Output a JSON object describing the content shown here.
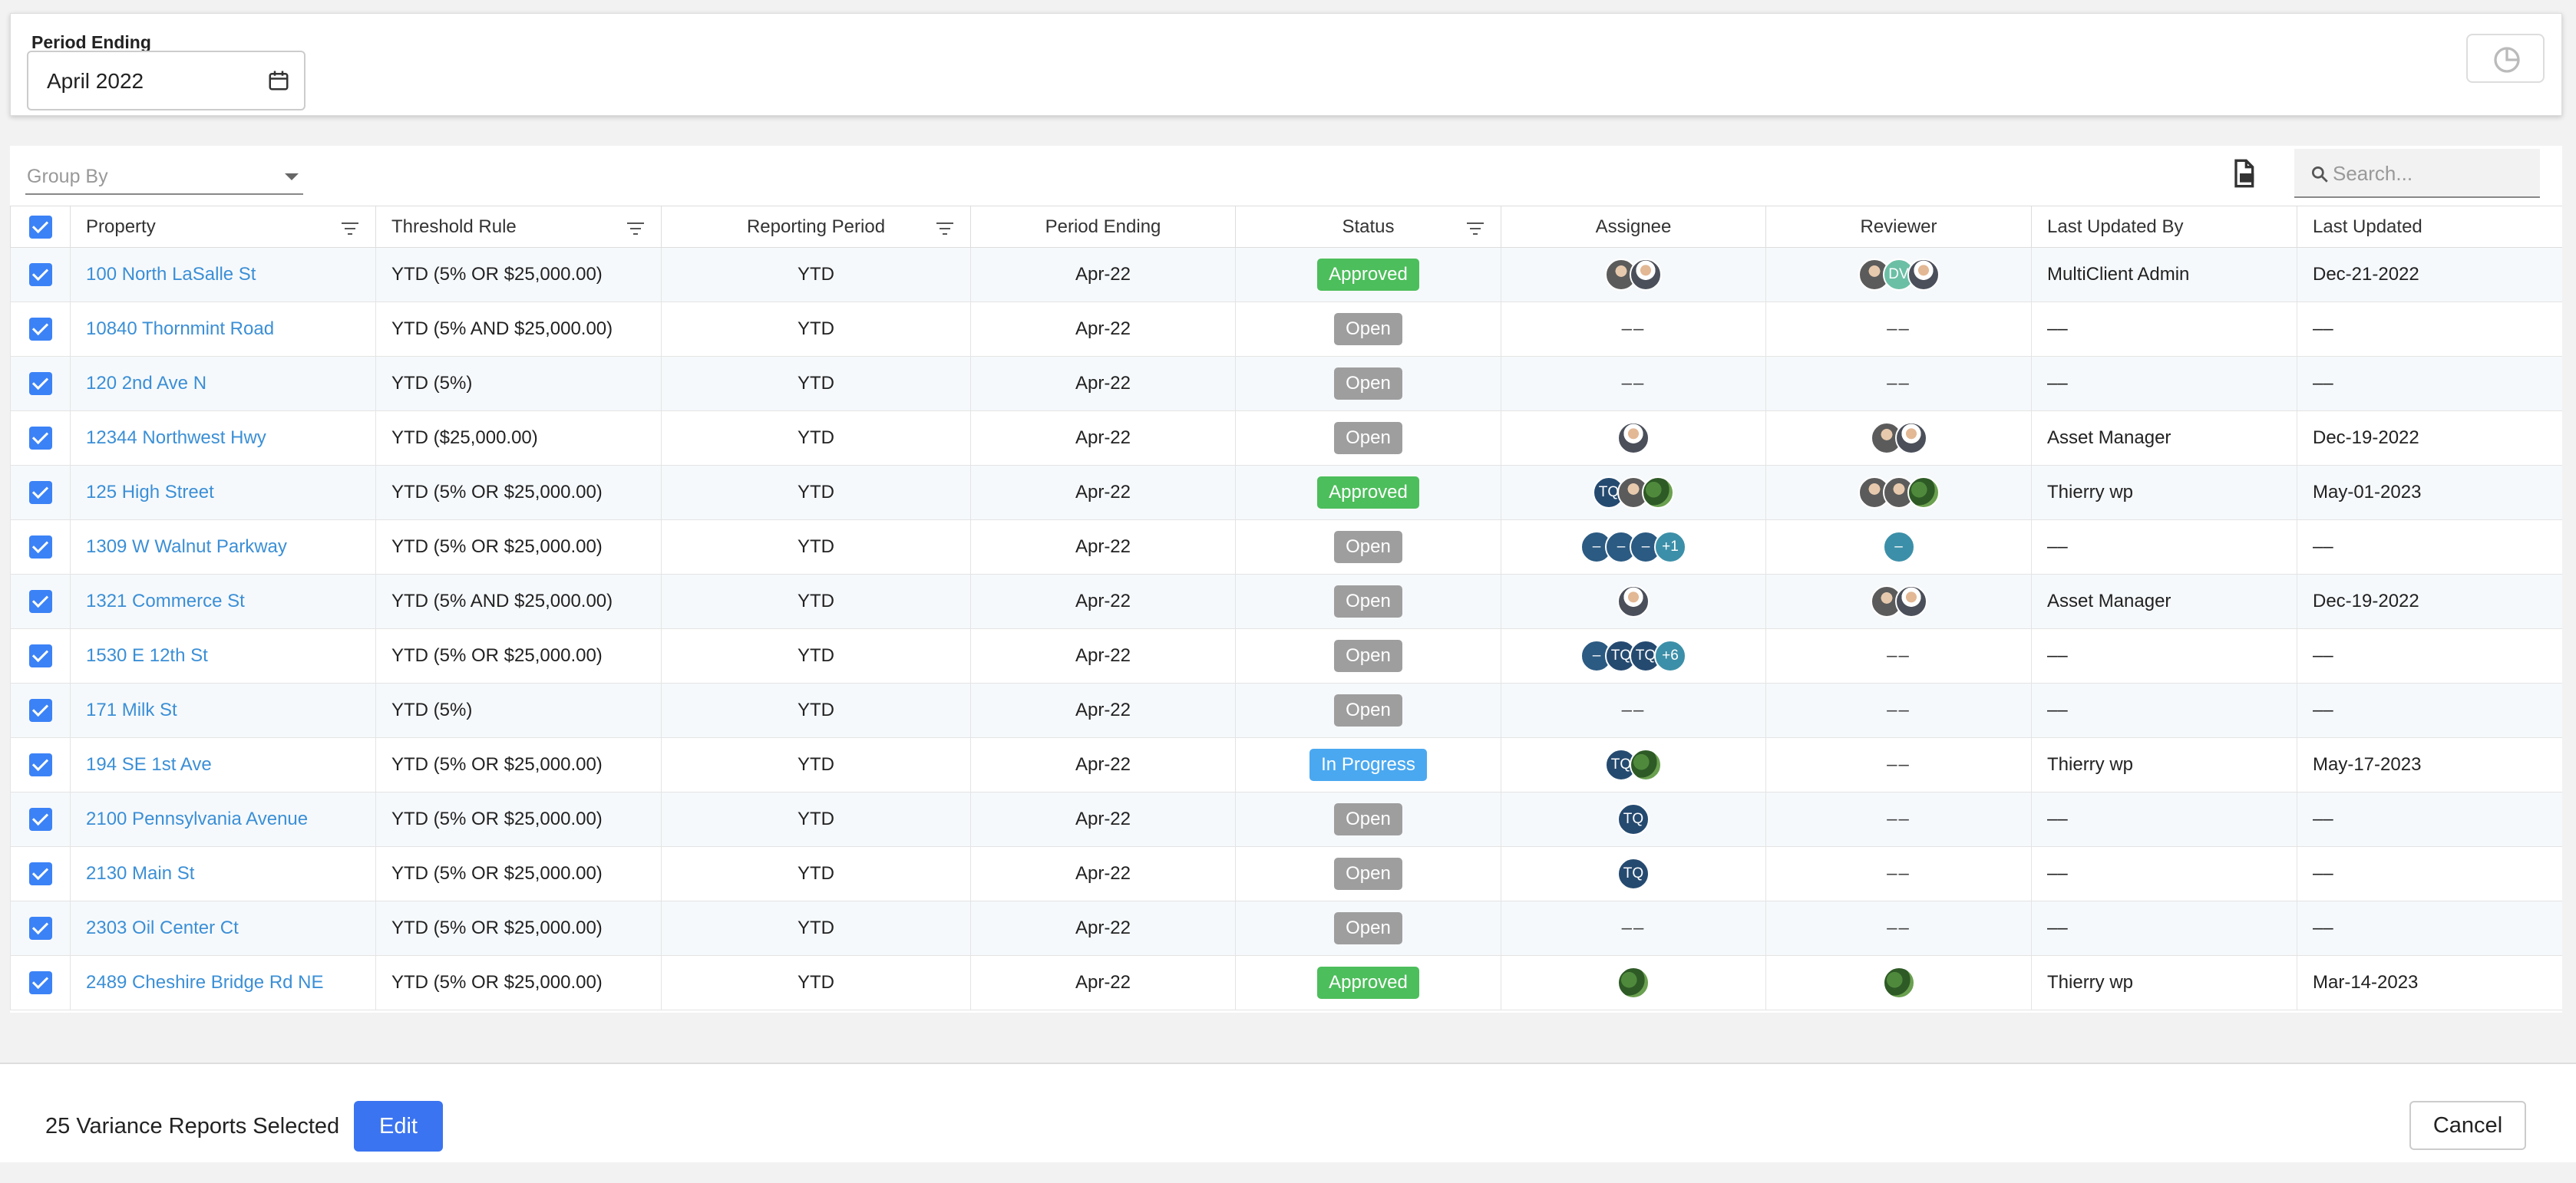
{
  "filter": {
    "period_label": "Period Ending",
    "period_value": "April 2022"
  },
  "toolbar": {
    "group_by_label": "Group By",
    "search_placeholder": "Search..."
  },
  "columns": [
    "Property",
    "Threshold Rule",
    "Reporting Period",
    "Period Ending",
    "Status",
    "Assignee",
    "Reviewer",
    "Last Updated By",
    "Last Updated"
  ],
  "rows": [
    {
      "property": "100 North LaSalle St",
      "rule": "YTD (5% OR $25,000.00)",
      "period": "YTD",
      "ending": "Apr-22",
      "status": "Approved",
      "status_type": "approved",
      "assignee": [
        "photo",
        "photo2"
      ],
      "reviewer": [
        "photo",
        "dv:DV",
        "photo2"
      ],
      "updated_by": "MultiClient Admin",
      "updated": "Dec-21-2022"
    },
    {
      "property": "10840 Thornmint Road",
      "rule": "YTD (5% AND $25,000.00)",
      "period": "YTD",
      "ending": "Apr-22",
      "status": "Open",
      "status_type": "open",
      "assignee": [],
      "reviewer": [],
      "updated_by": "--",
      "updated": "--"
    },
    {
      "property": "120 2nd Ave N",
      "rule": "YTD (5%)",
      "period": "YTD",
      "ending": "Apr-22",
      "status": "Open",
      "status_type": "open",
      "assignee": [],
      "reviewer": [],
      "updated_by": "--",
      "updated": "--"
    },
    {
      "property": "12344 Northwest Hwy",
      "rule": "YTD ($25,000.00)",
      "period": "YTD",
      "ending": "Apr-22",
      "status": "Open",
      "status_type": "open",
      "assignee": [
        "photo2"
      ],
      "reviewer": [
        "photo",
        "photo2"
      ],
      "updated_by": "Asset Manager",
      "updated": "Dec-19-2022"
    },
    {
      "property": "125 High Street",
      "rule": "YTD (5% OR $25,000.00)",
      "period": "YTD",
      "ending": "Apr-22",
      "status": "Approved",
      "status_type": "approved",
      "assignee": [
        "tq:TQ",
        "photo",
        "nature"
      ],
      "reviewer": [
        "photo",
        "photo",
        "nature"
      ],
      "updated_by": "Thierry wp",
      "updated": "May-01-2023"
    },
    {
      "property": "1309 W Walnut Parkway",
      "rule": "YTD (5% OR $25,000.00)",
      "period": "YTD",
      "ending": "Apr-22",
      "status": "Open",
      "status_type": "open",
      "assignee": [
        "dash:–",
        "dash:–",
        "dash:–",
        "plus:+1"
      ],
      "reviewer": [
        "teal:–"
      ],
      "updated_by": "--",
      "updated": "--"
    },
    {
      "property": "1321 Commerce St",
      "rule": "YTD (5% AND $25,000.00)",
      "period": "YTD",
      "ending": "Apr-22",
      "status": "Open",
      "status_type": "open",
      "assignee": [
        "photo2"
      ],
      "reviewer": [
        "photo",
        "photo2"
      ],
      "updated_by": "Asset Manager",
      "updated": "Dec-19-2022"
    },
    {
      "property": "1530 E 12th St",
      "rule": "YTD (5% OR $25,000.00)",
      "period": "YTD",
      "ending": "Apr-22",
      "status": "Open",
      "status_type": "open",
      "assignee": [
        "dash:–",
        "tq:TQ",
        "tq:TQ",
        "plus:+6"
      ],
      "reviewer": [],
      "updated_by": "--",
      "updated": "--"
    },
    {
      "property": "171 Milk St",
      "rule": "YTD (5%)",
      "period": "YTD",
      "ending": "Apr-22",
      "status": "Open",
      "status_type": "open",
      "assignee": [],
      "reviewer": [],
      "updated_by": "--",
      "updated": "--"
    },
    {
      "property": "194 SE 1st Ave",
      "rule": "YTD (5% OR $25,000.00)",
      "period": "YTD",
      "ending": "Apr-22",
      "status": "In Progress",
      "status_type": "inprogress",
      "assignee": [
        "tq:TQ",
        "nature"
      ],
      "reviewer": [],
      "updated_by": "Thierry wp",
      "updated": "May-17-2023"
    },
    {
      "property": "2100 Pennsylvania Avenue",
      "rule": "YTD (5% OR $25,000.00)",
      "period": "YTD",
      "ending": "Apr-22",
      "status": "Open",
      "status_type": "open",
      "assignee": [
        "tq:TQ"
      ],
      "reviewer": [],
      "updated_by": "--",
      "updated": "--"
    },
    {
      "property": "2130 Main St",
      "rule": "YTD (5% OR $25,000.00)",
      "period": "YTD",
      "ending": "Apr-22",
      "status": "Open",
      "status_type": "open",
      "assignee": [
        "tq:TQ"
      ],
      "reviewer": [],
      "updated_by": "--",
      "updated": "--"
    },
    {
      "property": "2303 Oil Center Ct",
      "rule": "YTD (5% OR $25,000.00)",
      "period": "YTD",
      "ending": "Apr-22",
      "status": "Open",
      "status_type": "open",
      "assignee": [],
      "reviewer": [],
      "updated_by": "--",
      "updated": "--"
    },
    {
      "property": "2489 Cheshire Bridge Rd NE",
      "rule": "YTD (5% OR $25,000.00)",
      "period": "YTD",
      "ending": "Apr-22",
      "status": "Approved",
      "status_type": "approved",
      "assignee": [
        "nature"
      ],
      "reviewer": [
        "nature"
      ],
      "updated_by": "Thierry wp",
      "updated": "Mar-14-2023"
    }
  ],
  "footer": {
    "selected_text": "25 Variance Reports Selected",
    "edit_label": "Edit",
    "cancel_label": "Cancel"
  },
  "colors": {
    "accent": "#3b74f0",
    "link": "#3b8fd6",
    "approved": "#4cbe5b",
    "open": "#9e9e9e",
    "in_progress": "#4aa8f0"
  },
  "icons": [
    "calendar-icon",
    "pie-chart-icon",
    "chevron-down-icon",
    "export-file-icon",
    "search-icon",
    "filter-icon",
    "checkbox-checked-icon"
  ]
}
